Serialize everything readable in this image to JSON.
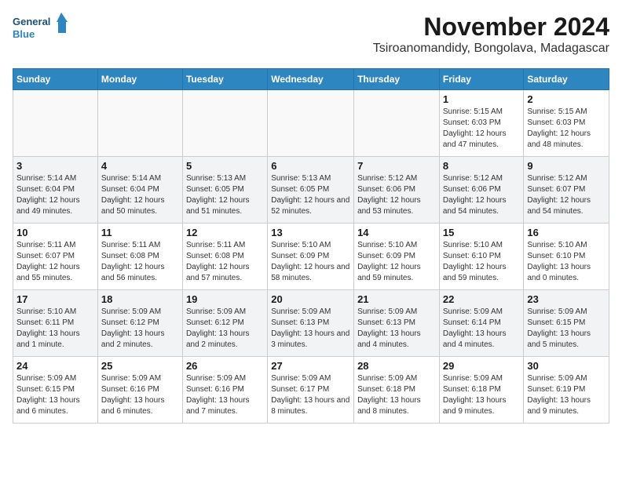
{
  "logo": {
    "line1": "General",
    "line2": "Blue"
  },
  "title": "November 2024",
  "subtitle": "Tsiroanomandidy, Bongolava, Madagascar",
  "days_of_week": [
    "Sunday",
    "Monday",
    "Tuesday",
    "Wednesday",
    "Thursday",
    "Friday",
    "Saturday"
  ],
  "weeks": [
    [
      {
        "day": "",
        "info": ""
      },
      {
        "day": "",
        "info": ""
      },
      {
        "day": "",
        "info": ""
      },
      {
        "day": "",
        "info": ""
      },
      {
        "day": "",
        "info": ""
      },
      {
        "day": "1",
        "info": "Sunrise: 5:15 AM\nSunset: 6:03 PM\nDaylight: 12 hours and 47 minutes."
      },
      {
        "day": "2",
        "info": "Sunrise: 5:15 AM\nSunset: 6:03 PM\nDaylight: 12 hours and 48 minutes."
      }
    ],
    [
      {
        "day": "3",
        "info": "Sunrise: 5:14 AM\nSunset: 6:04 PM\nDaylight: 12 hours and 49 minutes."
      },
      {
        "day": "4",
        "info": "Sunrise: 5:14 AM\nSunset: 6:04 PM\nDaylight: 12 hours and 50 minutes."
      },
      {
        "day": "5",
        "info": "Sunrise: 5:13 AM\nSunset: 6:05 PM\nDaylight: 12 hours and 51 minutes."
      },
      {
        "day": "6",
        "info": "Sunrise: 5:13 AM\nSunset: 6:05 PM\nDaylight: 12 hours and 52 minutes."
      },
      {
        "day": "7",
        "info": "Sunrise: 5:12 AM\nSunset: 6:06 PM\nDaylight: 12 hours and 53 minutes."
      },
      {
        "day": "8",
        "info": "Sunrise: 5:12 AM\nSunset: 6:06 PM\nDaylight: 12 hours and 54 minutes."
      },
      {
        "day": "9",
        "info": "Sunrise: 5:12 AM\nSunset: 6:07 PM\nDaylight: 12 hours and 54 minutes."
      }
    ],
    [
      {
        "day": "10",
        "info": "Sunrise: 5:11 AM\nSunset: 6:07 PM\nDaylight: 12 hours and 55 minutes."
      },
      {
        "day": "11",
        "info": "Sunrise: 5:11 AM\nSunset: 6:08 PM\nDaylight: 12 hours and 56 minutes."
      },
      {
        "day": "12",
        "info": "Sunrise: 5:11 AM\nSunset: 6:08 PM\nDaylight: 12 hours and 57 minutes."
      },
      {
        "day": "13",
        "info": "Sunrise: 5:10 AM\nSunset: 6:09 PM\nDaylight: 12 hours and 58 minutes."
      },
      {
        "day": "14",
        "info": "Sunrise: 5:10 AM\nSunset: 6:09 PM\nDaylight: 12 hours and 59 minutes."
      },
      {
        "day": "15",
        "info": "Sunrise: 5:10 AM\nSunset: 6:10 PM\nDaylight: 12 hours and 59 minutes."
      },
      {
        "day": "16",
        "info": "Sunrise: 5:10 AM\nSunset: 6:10 PM\nDaylight: 13 hours and 0 minutes."
      }
    ],
    [
      {
        "day": "17",
        "info": "Sunrise: 5:10 AM\nSunset: 6:11 PM\nDaylight: 13 hours and 1 minute."
      },
      {
        "day": "18",
        "info": "Sunrise: 5:09 AM\nSunset: 6:12 PM\nDaylight: 13 hours and 2 minutes."
      },
      {
        "day": "19",
        "info": "Sunrise: 5:09 AM\nSunset: 6:12 PM\nDaylight: 13 hours and 2 minutes."
      },
      {
        "day": "20",
        "info": "Sunrise: 5:09 AM\nSunset: 6:13 PM\nDaylight: 13 hours and 3 minutes."
      },
      {
        "day": "21",
        "info": "Sunrise: 5:09 AM\nSunset: 6:13 PM\nDaylight: 13 hours and 4 minutes."
      },
      {
        "day": "22",
        "info": "Sunrise: 5:09 AM\nSunset: 6:14 PM\nDaylight: 13 hours and 4 minutes."
      },
      {
        "day": "23",
        "info": "Sunrise: 5:09 AM\nSunset: 6:15 PM\nDaylight: 13 hours and 5 minutes."
      }
    ],
    [
      {
        "day": "24",
        "info": "Sunrise: 5:09 AM\nSunset: 6:15 PM\nDaylight: 13 hours and 6 minutes."
      },
      {
        "day": "25",
        "info": "Sunrise: 5:09 AM\nSunset: 6:16 PM\nDaylight: 13 hours and 6 minutes."
      },
      {
        "day": "26",
        "info": "Sunrise: 5:09 AM\nSunset: 6:16 PM\nDaylight: 13 hours and 7 minutes."
      },
      {
        "day": "27",
        "info": "Sunrise: 5:09 AM\nSunset: 6:17 PM\nDaylight: 13 hours and 8 minutes."
      },
      {
        "day": "28",
        "info": "Sunrise: 5:09 AM\nSunset: 6:18 PM\nDaylight: 13 hours and 8 minutes."
      },
      {
        "day": "29",
        "info": "Sunrise: 5:09 AM\nSunset: 6:18 PM\nDaylight: 13 hours and 9 minutes."
      },
      {
        "day": "30",
        "info": "Sunrise: 5:09 AM\nSunset: 6:19 PM\nDaylight: 13 hours and 9 minutes."
      }
    ]
  ]
}
